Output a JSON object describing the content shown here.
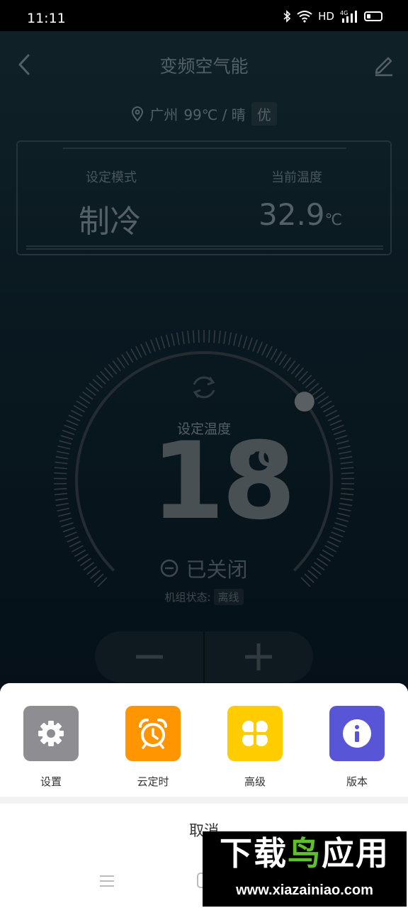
{
  "status_bar": {
    "time": "11:11",
    "network_label": "HD",
    "cellular_label": "4G"
  },
  "header": {
    "title": "变频空气能"
  },
  "location": {
    "city": "广州",
    "weather": "99℃ / 晴",
    "air_quality": "优"
  },
  "info_card": {
    "mode_label": "设定模式",
    "mode_value": "制冷",
    "current_temp_label": "当前温度",
    "current_temp_value": "32.9",
    "current_temp_unit": "℃"
  },
  "dial": {
    "set_temp_label": "设定温度",
    "set_temp_value": "18",
    "set_temp_unit": "℃",
    "power_state": "已关闭",
    "unit_status_label": "机组状态:",
    "unit_status_value": "离线"
  },
  "action_sheet": {
    "items": [
      {
        "label": "设置",
        "icon": "gear-icon",
        "color": "#8e8e92"
      },
      {
        "label": "云定时",
        "icon": "alarm-clock-icon",
        "color": "#ff9500"
      },
      {
        "label": "高级",
        "icon": "four-leaf-icon",
        "color": "#ffcc00"
      },
      {
        "label": "版本",
        "icon": "info-icon",
        "color": "#5856d6"
      }
    ],
    "cancel_label": "取消"
  },
  "watermark": {
    "part1": "下载",
    "part2": "鸟",
    "part3": "应用",
    "url": "www.xiazainiao.com"
  },
  "colors": {
    "background_top": "#1b3a44",
    "background_bottom": "#07131e",
    "dim_text": "#8fa7b0",
    "watermark_green": "#5fc12a"
  }
}
